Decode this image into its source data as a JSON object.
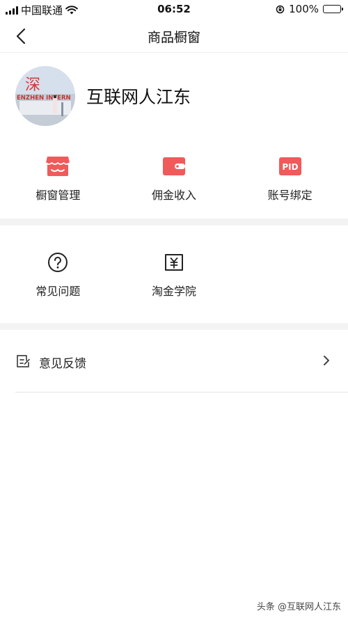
{
  "status_bar": {
    "carrier": "中国联通",
    "time": "06:52",
    "battery": "100%"
  },
  "nav": {
    "title": "商品橱窗",
    "back_icon": "chevron-left-icon"
  },
  "profile": {
    "name": "互联网人江东",
    "avatar_text": "深",
    "avatar_caption": "ENZHEN INTERN"
  },
  "features_row1": [
    {
      "label": "橱窗管理",
      "icon": "storefront-icon"
    },
    {
      "label": "佣金收入",
      "icon": "wallet-icon"
    },
    {
      "label": "账号绑定",
      "icon": "pid-icon",
      "icon_text": "PID"
    }
  ],
  "features_row2": [
    {
      "label": "常见问题",
      "icon": "question-icon"
    },
    {
      "label": "淘金学院",
      "icon": "yuan-book-icon"
    }
  ],
  "feedback": {
    "label": "意见反馈",
    "icon": "feedback-icon",
    "chevron": "chevron-right-icon"
  },
  "watermark": "头条 @互联网人江东",
  "colors": {
    "accent": "#f05a5a",
    "divider": "#f3f3f3"
  }
}
